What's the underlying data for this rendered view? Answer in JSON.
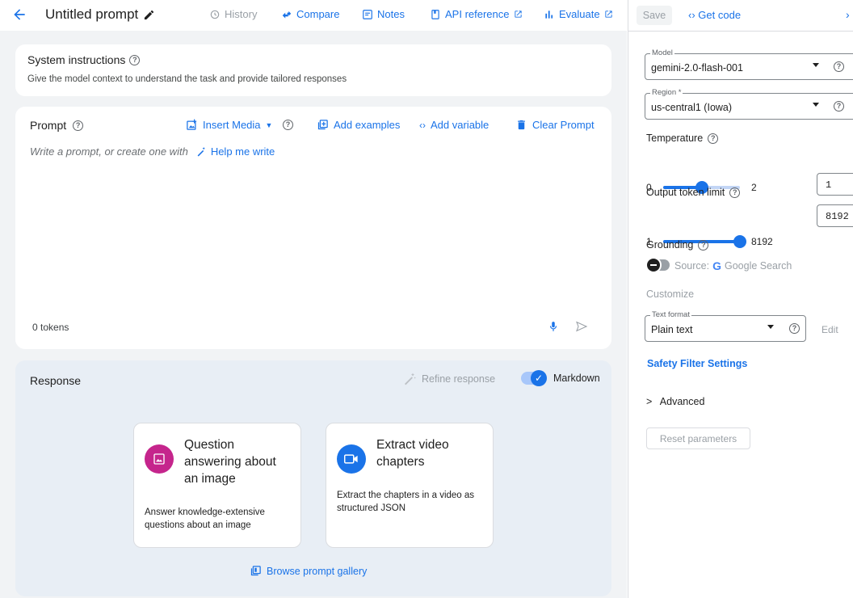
{
  "header": {
    "title": "Untitled prompt",
    "nav": {
      "history": "History",
      "compare": "Compare",
      "notes": "Notes",
      "api_reference": "API reference",
      "evaluate": "Evaluate"
    }
  },
  "system_instructions": {
    "title": "System instructions",
    "subtitle": "Give the model context to understand the task and provide tailored responses"
  },
  "prompt": {
    "title": "Prompt",
    "insert_media": "Insert Media",
    "add_examples": "Add examples",
    "add_variable": "Add variable",
    "clear_prompt": "Clear Prompt",
    "placeholder": "Write a prompt, or create one with",
    "help_me_write": "Help me write",
    "tokens": "0 tokens"
  },
  "response": {
    "title": "Response",
    "refine": "Refine response",
    "markdown": "Markdown",
    "markdown_enabled": true,
    "gallery": [
      {
        "title": "Question answering about an image",
        "description": "Answer knowledge-extensive questions about an image",
        "icon": "image-icon",
        "color": "#c5258c"
      },
      {
        "title": "Extract video chapters",
        "description": "Extract the chapters in a video as structured JSON",
        "icon": "video-icon",
        "color": "#1a73e8"
      }
    ],
    "browse": "Browse prompt gallery"
  },
  "panel": {
    "save": "Save",
    "get_code": "Get code",
    "model": {
      "label": "Model",
      "value": "gemini-2.0-flash-001"
    },
    "region": {
      "label": "Region *",
      "value": "us-central1 (Iowa)"
    },
    "temperature": {
      "label": "Temperature",
      "min": "0",
      "max": "2",
      "value": "1",
      "fraction": 0.5
    },
    "output_token_limit": {
      "label": "Output token limit",
      "min": "1",
      "max": "8192",
      "value": "8192",
      "fraction": 1.0
    },
    "grounding": {
      "label": "Grounding",
      "source": "Source:",
      "google_search": "Google Search",
      "enabled": false
    },
    "customize": "Customize",
    "text_format": {
      "label": "Text format",
      "value": "Plain text"
    },
    "edit": "Edit",
    "safety_filter": "Safety Filter Settings",
    "advanced": "Advanced",
    "reset": "Reset parameters"
  },
  "colors": {
    "accent": "#1a73e8",
    "muted": "#9aa0a6"
  }
}
